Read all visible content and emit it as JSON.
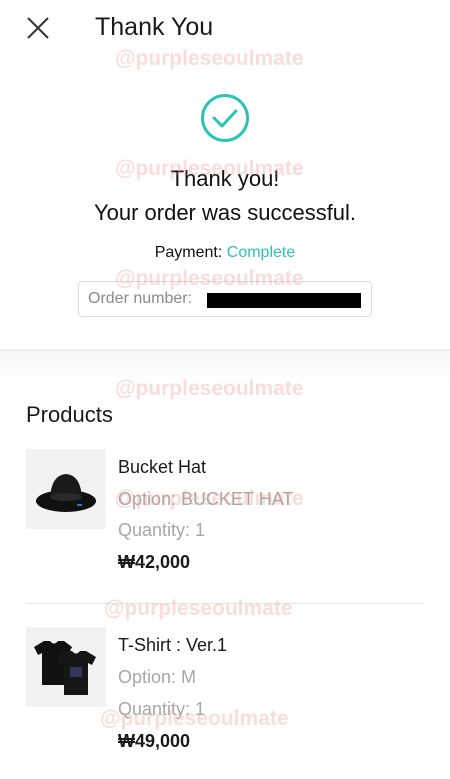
{
  "header": {
    "title": "Thank You",
    "close_icon": "close-icon"
  },
  "status": {
    "icon": "check-circle-icon",
    "accent_color": "#2cc3b5",
    "line1": "Thank you!",
    "line2": "Your order was successful.",
    "payment_label": "Payment: ",
    "payment_status": "Complete"
  },
  "order": {
    "label": "Order number:",
    "value_redacted": true
  },
  "products": {
    "title": "Products",
    "items": [
      {
        "name": "Bucket Hat",
        "option": "Option: BUCKET HAT",
        "quantity": "Quantity: 1",
        "price": "₩42,000",
        "thumbnail": "bucket-hat-image"
      },
      {
        "name": "T-Shirt : Ver.1",
        "option": "Option: M",
        "quantity": "Quantity: 1",
        "price": "₩49,000",
        "thumbnail": "t-shirt-image"
      }
    ]
  },
  "watermark": "@purpleseoulmate"
}
